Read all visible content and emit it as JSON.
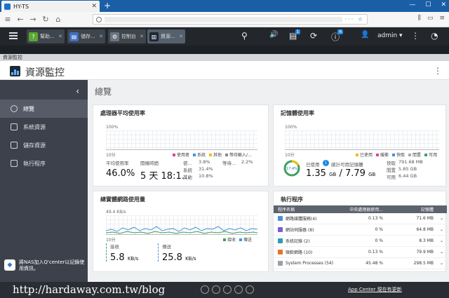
{
  "browser": {
    "tab_title": "HY-TS",
    "new_tab_symbol": "+",
    "win_controls": [
      "—",
      "☐",
      "✕"
    ],
    "nav": [
      "←",
      "→",
      "↻",
      "⌂"
    ],
    "url_actions": "··· ☆",
    "right_icons": [
      "⫼",
      "▭",
      "≡"
    ]
  },
  "qts": {
    "apps": [
      {
        "label": "幫助...",
        "glyph": "?",
        "color": "#5aa832"
      },
      {
        "label": "儲存...",
        "glyph": "▤",
        "color": "#3f6fc2"
      },
      {
        "label": "控制台",
        "glyph": "⚙",
        "color": "#6c7480"
      },
      {
        "label": "資源...",
        "glyph": "▥",
        "color": "#1f2733"
      }
    ],
    "icons": {
      "search": "⚲",
      "volume": "🔊",
      "tasks": "⟳",
      "info": "ⓘ",
      "user": "👤",
      "menu": "⋮",
      "gauge": "◔"
    },
    "badges": {
      "tasks": "1",
      "info": "6"
    },
    "user_label": "admin ▾"
  },
  "window": {
    "title_bar": "資源監控",
    "title": "資源監控",
    "kebab": "⋮"
  },
  "sidebar": {
    "collapse": "‹",
    "items": [
      "總覽",
      "系統資源",
      "儲存資源",
      "執行程序"
    ],
    "note": "將NAS加入Q'center以記錄使用資訊。"
  },
  "main": {
    "title": "總覽",
    "cpu": {
      "title": "處理器平均使用率",
      "y_top": "100%",
      "x_label": "10分",
      "legend": [
        "使用者",
        "系統",
        "其他",
        "等待輸入/..."
      ],
      "legend_colors": [
        "#e040a0",
        "#4a90d9",
        "#f0c000",
        "#888888"
      ],
      "label_now": "平均使用率",
      "value_now": "46.0%",
      "label_time": "開機時間",
      "value_time": "5 天 18:1...",
      "stats": [
        {
          "k": "使...",
          "v": "3.8%"
        },
        {
          "k": "系統",
          "v": "31.4%"
        },
        {
          "k": "其他",
          "v": "10.8%"
        }
      ],
      "wait_k": "等待...",
      "wait_v": "2.2%"
    },
    "memory": {
      "title": "記憶體使用率",
      "y_top": "100%",
      "x_label": "10分",
      "legend": [
        "已使用",
        "緩衝",
        "快取",
        "閒置",
        "可用"
      ],
      "legend_colors": [
        "#f0c000",
        "#e040a0",
        "#4a90d9",
        "#aaaaaa",
        "#3fa060"
      ],
      "ring_pct": "17.4%",
      "used_label": "已使用",
      "total_label": "總計可用記憶體",
      "used": "1.35",
      "used_unit": "GB",
      "sep": "/",
      "total": "7.79",
      "total_unit": "GB",
      "side": [
        {
          "k": "快取",
          "v": "791.68 MB"
        },
        {
          "k": "閒置",
          "v": "5.85 GB"
        },
        {
          "k": "可用",
          "v": "6.44 GB"
        }
      ]
    },
    "network": {
      "title": "總實體網路使用量",
      "y_top": "49.4 KB/s",
      "x_label": "10分",
      "legend": [
        "接收",
        "傳送"
      ],
      "legend_colors": [
        "#3fa060",
        "#4a90d9"
      ],
      "rx_label": "接收",
      "rx_value": "5.8",
      "rx_unit": "KB/s",
      "tx_label": "傳送",
      "tx_value": "25.8",
      "tx_unit": "KB/s"
    },
    "processes": {
      "title": "執行程序",
      "headers": [
        "程序名稱",
        "中央處理器使用...",
        "記憶體"
      ],
      "rows": [
        {
          "name": "網路媒體服務(4)",
          "cpu": "0.13 %",
          "mem": "71.6 MB"
        },
        {
          "name": "網站伺服器 (8)",
          "cpu": "0 %",
          "mem": "64.8 MB"
        },
        {
          "name": "系統記錄 (2)",
          "cpu": "0 %",
          "mem": "8.3 MB"
        },
        {
          "name": "微軟網路 (10)",
          "cpu": "0.13 %",
          "mem": "79.9 MB"
        },
        {
          "name": "System Processes (54)",
          "cpu": "45.48 %",
          "mem": "298.5 MB"
        }
      ],
      "expand": "⌄"
    }
  },
  "watermark": {
    "text": "http://hardaway.com.tw/blog",
    "link": "App Center 現在有更新"
  }
}
